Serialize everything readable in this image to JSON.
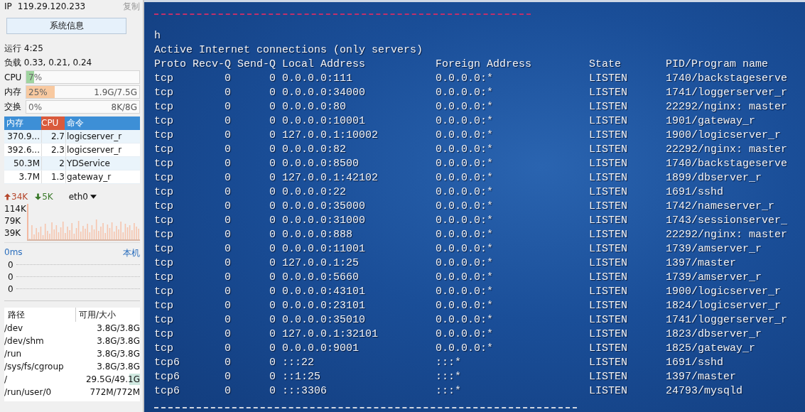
{
  "sidebar": {
    "ip_label": "IP",
    "ip": "119.29.120.233",
    "copy": "复制",
    "sysinfo_button": "系统信息",
    "uptime": {
      "label": "运行",
      "value": "4:25"
    },
    "load": {
      "label": "负载",
      "value": "0.33, 0.21, 0.24"
    },
    "meters": [
      {
        "label": "CPU",
        "percent": "7%",
        "level": 0.07,
        "color": "#9fd49f"
      },
      {
        "label": "内存",
        "percent": "25%",
        "level": 0.25,
        "color": "#f8c9a0",
        "usage": "1.9G/7.5G"
      },
      {
        "label": "交换",
        "percent": "0%",
        "usage": "8K/8G"
      }
    ],
    "processes": {
      "columns": [
        "内存",
        "CPU",
        "命令"
      ],
      "rows": [
        {
          "mem": "370.9...",
          "cpu": "2.7",
          "cmd": "logicserver_r"
        },
        {
          "mem": "392.6...",
          "cpu": "2.3",
          "cmd": "logicserver_r"
        },
        {
          "mem": "50.3M",
          "cpu": "2",
          "cmd": "YDService"
        },
        {
          "mem": "3.7M",
          "cpu": "1.3",
          "cmd": "gateway_r"
        }
      ]
    },
    "network": {
      "up": "34K",
      "down": "5K",
      "interface": "eth0",
      "scale": [
        "114K",
        "79K",
        "39K"
      ]
    },
    "latency": {
      "value": "0ms",
      "target": "本机",
      "scale": [
        "0",
        "0",
        "0"
      ]
    },
    "disks": {
      "columns": [
        "路径",
        "可用/大小"
      ],
      "rows": [
        {
          "path": "/dev",
          "usage": "3.8G/3.8G"
        },
        {
          "path": "/dev/shm",
          "usage": "3.8G/3.8G"
        },
        {
          "path": "/run",
          "usage": "3.8G/3.8G"
        },
        {
          "path": "/sys/fs/cgroup",
          "usage": "3.8G/3.8G"
        },
        {
          "path": "/",
          "usage": "29.5G/49.1G",
          "level": 0.16
        },
        {
          "path": "/run/user/0",
          "usage": "772M/772M"
        }
      ]
    }
  },
  "terminal": {
    "lines": [
      "h",
      "Active Internet connections (only servers)"
    ],
    "columns": [
      "Proto",
      "Recv-Q",
      "Send-Q",
      "Local Address",
      "Foreign Address",
      "State",
      "PID/Program name"
    ],
    "rows": [
      [
        "tcp",
        "0",
        "0",
        "0.0.0.0:111",
        "0.0.0.0:*",
        "LISTEN",
        "1740/backstageserve"
      ],
      [
        "tcp",
        "0",
        "0",
        "0.0.0.0:34000",
        "0.0.0.0:*",
        "LISTEN",
        "1741/loggerserver_r"
      ],
      [
        "tcp",
        "0",
        "0",
        "0.0.0.0:80",
        "0.0.0.0:*",
        "LISTEN",
        "22292/nginx: master"
      ],
      [
        "tcp",
        "0",
        "0",
        "0.0.0.0:10001",
        "0.0.0.0:*",
        "LISTEN",
        "1901/gateway_r"
      ],
      [
        "tcp",
        "0",
        "0",
        "127.0.0.1:10002",
        "0.0.0.0:*",
        "LISTEN",
        "1900/logicserver_r"
      ],
      [
        "tcp",
        "0",
        "0",
        "0.0.0.0:82",
        "0.0.0.0:*",
        "LISTEN",
        "22292/nginx: master"
      ],
      [
        "tcp",
        "0",
        "0",
        "0.0.0.0:8500",
        "0.0.0.0:*",
        "LISTEN",
        "1740/backstageserve"
      ],
      [
        "tcp",
        "0",
        "0",
        "127.0.0.1:42102",
        "0.0.0.0:*",
        "LISTEN",
        "1899/dbserver_r"
      ],
      [
        "tcp",
        "0",
        "0",
        "0.0.0.0:22",
        "0.0.0.0:*",
        "LISTEN",
        "1691/sshd"
      ],
      [
        "tcp",
        "0",
        "0",
        "0.0.0.0:35000",
        "0.0.0.0:*",
        "LISTEN",
        "1742/nameserver_r"
      ],
      [
        "tcp",
        "0",
        "0",
        "0.0.0.0:31000",
        "0.0.0.0:*",
        "LISTEN",
        "1743/sessionserver_"
      ],
      [
        "tcp",
        "0",
        "0",
        "0.0.0.0:888",
        "0.0.0.0:*",
        "LISTEN",
        "22292/nginx: master"
      ],
      [
        "tcp",
        "0",
        "0",
        "0.0.0.0:11001",
        "0.0.0.0:*",
        "LISTEN",
        "1739/amserver_r"
      ],
      [
        "tcp",
        "0",
        "0",
        "127.0.0.1:25",
        "0.0.0.0:*",
        "LISTEN",
        "1397/master"
      ],
      [
        "tcp",
        "0",
        "0",
        "0.0.0.0:5660",
        "0.0.0.0:*",
        "LISTEN",
        "1739/amserver_r"
      ],
      [
        "tcp",
        "0",
        "0",
        "0.0.0.0:43101",
        "0.0.0.0:*",
        "LISTEN",
        "1900/logicserver_r"
      ],
      [
        "tcp",
        "0",
        "0",
        "0.0.0.0:23101",
        "0.0.0.0:*",
        "LISTEN",
        "1824/logicserver_r"
      ],
      [
        "tcp",
        "0",
        "0",
        "0.0.0.0:35010",
        "0.0.0.0:*",
        "LISTEN",
        "1741/loggerserver_r"
      ],
      [
        "tcp",
        "0",
        "0",
        "127.0.0.1:32101",
        "0.0.0.0:*",
        "LISTEN",
        "1823/dbserver_r"
      ],
      [
        "tcp",
        "0",
        "0",
        "0.0.0.0:9001",
        "0.0.0.0:*",
        "LISTEN",
        "1825/gateway_r"
      ],
      [
        "tcp6",
        "0",
        "0",
        ":::22",
        ":::*",
        "LISTEN",
        "1691/sshd"
      ],
      [
        "tcp6",
        "0",
        "0",
        "::1:25",
        ":::*",
        "LISTEN",
        "1397/master"
      ],
      [
        "tcp6",
        "0",
        "0",
        ":::3306",
        ":::*",
        "LISTEN",
        "24793/mysqld"
      ]
    ]
  }
}
